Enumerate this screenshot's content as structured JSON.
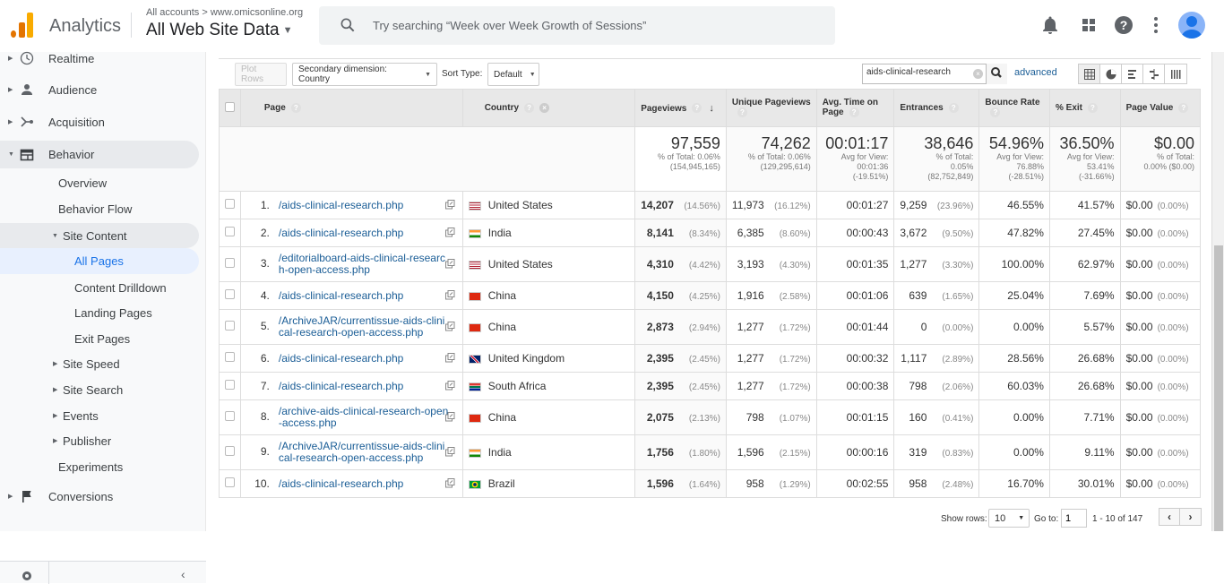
{
  "header": {
    "brand": "Analytics",
    "breadcrumb": "All accounts > www.omicsonline.org",
    "property": "All Web Site Data",
    "search_placeholder": "Try searching “Week over Week Growth of Sessions”",
    "icons": [
      "bell-icon",
      "apps-grid-icon",
      "help-icon",
      "more-vert-icon",
      "account-avatar-icon"
    ]
  },
  "sidebar": {
    "items": [
      {
        "label": "Realtime",
        "icon": "clock-icon"
      },
      {
        "label": "Audience",
        "icon": "person-icon"
      },
      {
        "label": "Acquisition",
        "icon": "acquisition-icon"
      },
      {
        "label": "Behavior",
        "icon": "behavior-icon"
      },
      {
        "label": "Overview"
      },
      {
        "label": "Behavior Flow"
      },
      {
        "label": "Site Content"
      },
      {
        "label": "All Pages"
      },
      {
        "label": "Content Drilldown"
      },
      {
        "label": "Landing Pages"
      },
      {
        "label": "Exit Pages"
      },
      {
        "label": "Site Speed"
      },
      {
        "label": "Site Search"
      },
      {
        "label": "Events"
      },
      {
        "label": "Publisher"
      },
      {
        "label": "Experiments"
      },
      {
        "label": "Conversions",
        "icon": "flag-icon"
      }
    ]
  },
  "toolbar": {
    "plot_rows": "Plot Rows",
    "secondary_dimension": "Secondary dimension: Country",
    "sort_type_label": "Sort Type:",
    "sort_type_value": "Default",
    "filter_value": "aids-clinical-research",
    "advanced": "advanced"
  },
  "table": {
    "headers": {
      "page": "Page",
      "country": "Country",
      "pageviews": "Pageviews",
      "unique_pageviews": "Unique Pageviews",
      "avg_time": "Avg. Time on Page",
      "entrances": "Entrances",
      "bounce_rate": "Bounce Rate",
      "exit": "% Exit",
      "page_value": "Page Value"
    },
    "totals": {
      "pageviews": {
        "value": "97,559",
        "l1": "% of Total: 0.06%",
        "l2": "(154,945,165)"
      },
      "unique_pageviews": {
        "value": "74,262",
        "l1": "% of Total: 0.06%",
        "l2": "(129,295,614)"
      },
      "avg_time": {
        "value": "00:01:17",
        "l1": "Avg for View:",
        "l2": "00:01:36",
        "l3": "(-19.51%)"
      },
      "entrances": {
        "value": "38,646",
        "l1": "% of Total:",
        "l2": "0.05%",
        "l3": "(82,752,849)"
      },
      "bounce_rate": {
        "value": "54.96%",
        "l1": "Avg for View:",
        "l2": "76.88%",
        "l3": "(-28.51%)"
      },
      "exit": {
        "value": "36.50%",
        "l1": "Avg for View:",
        "l2": "53.41%",
        "l3": "(-31.66%)"
      },
      "page_value": {
        "value": "$0.00",
        "l1": "% of Total:",
        "l2": "0.00% ($0.00)"
      }
    },
    "rows": [
      {
        "idx": "1.",
        "page": "/aids-clinical-research.php",
        "country": "United States",
        "flag": "us",
        "pv": "14,207",
        "pv_pct": "(14.56%)",
        "upv": "11,973",
        "upv_pct": "(16.12%)",
        "time": "00:01:27",
        "ent": "9,259",
        "ent_pct": "(23.96%)",
        "bounce": "46.55%",
        "exit": "41.57%",
        "value": "$0.00",
        "value_pct": "(0.00%)"
      },
      {
        "idx": "2.",
        "page": "/aids-clinical-research.php",
        "country": "India",
        "flag": "in",
        "pv": "8,141",
        "pv_pct": "(8.34%)",
        "upv": "6,385",
        "upv_pct": "(8.60%)",
        "time": "00:00:43",
        "ent": "3,672",
        "ent_pct": "(9.50%)",
        "bounce": "47.82%",
        "exit": "27.45%",
        "value": "$0.00",
        "value_pct": "(0.00%)"
      },
      {
        "idx": "3.",
        "page": "/editorialboard-aids-clinical-research-open-access.php",
        "country": "United States",
        "flag": "us",
        "pv": "4,310",
        "pv_pct": "(4.42%)",
        "upv": "3,193",
        "upv_pct": "(4.30%)",
        "time": "00:01:35",
        "ent": "1,277",
        "ent_pct": "(3.30%)",
        "bounce": "100.00%",
        "exit": "62.97%",
        "value": "$0.00",
        "value_pct": "(0.00%)"
      },
      {
        "idx": "4.",
        "page": "/aids-clinical-research.php",
        "country": "China",
        "flag": "cn",
        "pv": "4,150",
        "pv_pct": "(4.25%)",
        "upv": "1,916",
        "upv_pct": "(2.58%)",
        "time": "00:01:06",
        "ent": "639",
        "ent_pct": "(1.65%)",
        "bounce": "25.04%",
        "exit": "7.69%",
        "value": "$0.00",
        "value_pct": "(0.00%)"
      },
      {
        "idx": "5.",
        "page": "/ArchiveJAR/currentissue-aids-clinical-research-open-access.php",
        "country": "China",
        "flag": "cn",
        "pv": "2,873",
        "pv_pct": "(2.94%)",
        "upv": "1,277",
        "upv_pct": "(1.72%)",
        "time": "00:01:44",
        "ent": "0",
        "ent_pct": "(0.00%)",
        "bounce": "0.00%",
        "exit": "5.57%",
        "value": "$0.00",
        "value_pct": "(0.00%)"
      },
      {
        "idx": "6.",
        "page": "/aids-clinical-research.php",
        "country": "United Kingdom",
        "flag": "gb",
        "pv": "2,395",
        "pv_pct": "(2.45%)",
        "upv": "1,277",
        "upv_pct": "(1.72%)",
        "time": "00:00:32",
        "ent": "1,117",
        "ent_pct": "(2.89%)",
        "bounce": "28.56%",
        "exit": "26.68%",
        "value": "$0.00",
        "value_pct": "(0.00%)"
      },
      {
        "idx": "7.",
        "page": "/aids-clinical-research.php",
        "country": "South Africa",
        "flag": "za",
        "pv": "2,395",
        "pv_pct": "(2.45%)",
        "upv": "1,277",
        "upv_pct": "(1.72%)",
        "time": "00:00:38",
        "ent": "798",
        "ent_pct": "(2.06%)",
        "bounce": "60.03%",
        "exit": "26.68%",
        "value": "$0.00",
        "value_pct": "(0.00%)"
      },
      {
        "idx": "8.",
        "page": "/archive-aids-clinical-research-open-access.php",
        "country": "China",
        "flag": "cn",
        "pv": "2,075",
        "pv_pct": "(2.13%)",
        "upv": "798",
        "upv_pct": "(1.07%)",
        "time": "00:01:15",
        "ent": "160",
        "ent_pct": "(0.41%)",
        "bounce": "0.00%",
        "exit": "7.71%",
        "value": "$0.00",
        "value_pct": "(0.00%)"
      },
      {
        "idx": "9.",
        "page": "/ArchiveJAR/currentissue-aids-clinical-research-open-access.php",
        "country": "India",
        "flag": "in",
        "pv": "1,756",
        "pv_pct": "(1.80%)",
        "upv": "1,596",
        "upv_pct": "(2.15%)",
        "time": "00:00:16",
        "ent": "319",
        "ent_pct": "(0.83%)",
        "bounce": "0.00%",
        "exit": "9.11%",
        "value": "$0.00",
        "value_pct": "(0.00%)"
      },
      {
        "idx": "10.",
        "page": "/aids-clinical-research.php",
        "country": "Brazil",
        "flag": "br",
        "pv": "1,596",
        "pv_pct": "(1.64%)",
        "upv": "958",
        "upv_pct": "(1.29%)",
        "time": "00:02:55",
        "ent": "958",
        "ent_pct": "(2.48%)",
        "bounce": "16.70%",
        "exit": "30.01%",
        "value": "$0.00",
        "value_pct": "(0.00%)"
      }
    ]
  },
  "pagination": {
    "show_rows_label": "Show rows:",
    "show_rows_value": "10",
    "goto_label": "Go to:",
    "goto_value": "1",
    "range": "1 - 10 of 147"
  },
  "colors": {
    "link": "#1a5d96",
    "active_nav": "#1a73e8",
    "logo_dark": "#e37400",
    "logo_light": "#f9ab00"
  }
}
